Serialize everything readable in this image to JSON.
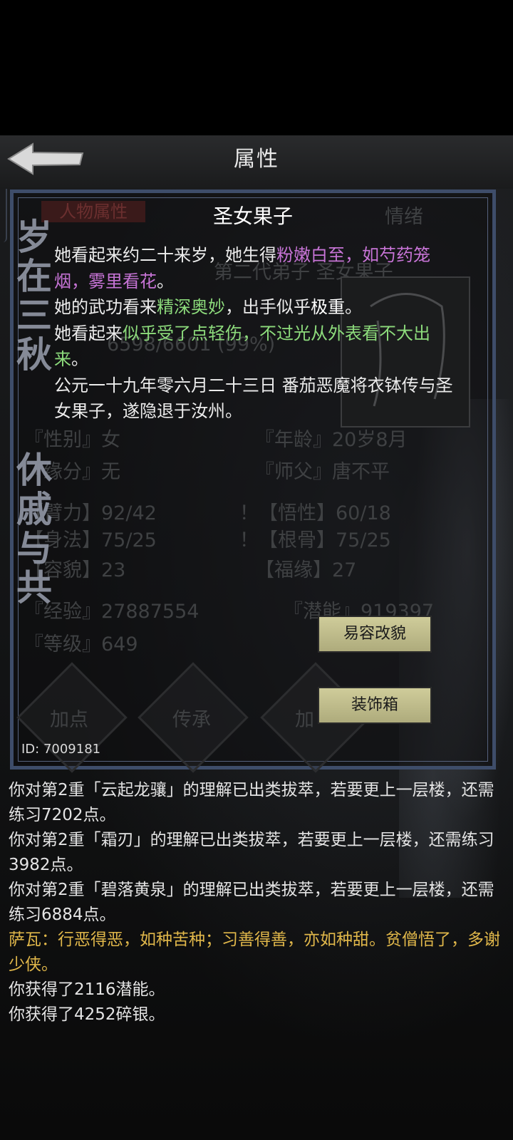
{
  "header": {
    "title": "属性"
  },
  "background": {
    "tab_active": "人物属性",
    "tab_right": "情绪",
    "name_line": "第二代弟子 圣女果子",
    "hp_line": "6598/6601 (99%)",
    "stats_rows": [
      {
        "left": "『性别』女",
        "right": "『年龄』20岁8月"
      },
      {
        "left": "『缘分』无",
        "right": "『师父』唐不平"
      },
      {
        "left": "【臂力】92/42",
        "right": "！【悟性】60/18"
      },
      {
        "left": "【身法】75/25",
        "right": "！【根骨】75/25"
      },
      {
        "left": "【容貌】23",
        "right": "【福缘】27"
      }
    ],
    "exp": "『经验』27887554",
    "potential": "『潜能』919397",
    "level": "『等级』649",
    "diamonds": [
      "加点",
      "传承",
      "加"
    ],
    "calligraphy_top": [
      "岁",
      "在",
      "三",
      "秋"
    ],
    "calligraphy_bottom": [
      "休",
      "戚",
      "与",
      "共"
    ]
  },
  "popup": {
    "title": "圣女果子",
    "p1": {
      "a": "她看起来约二十来岁，她生得",
      "b": "粉嫩白至，如芍药笼烟，雾里看花",
      "c": "。"
    },
    "p2": {
      "a": "她的武功看来",
      "b": "精深奥妙",
      "c": "，出手似乎",
      "d": "极重",
      "e": "。"
    },
    "p3": {
      "a": "她看起来",
      "b": "似乎受了点轻伤，不过光从外表看不大出来",
      "c": "。"
    },
    "p4": "公元一十九年零六月二十三日 番茄恶魔将衣钵传与圣女果子，遂隐退于汝州。"
  },
  "buttons": {
    "disguise": "易容改貌",
    "wardrobe": "装饰箱"
  },
  "id_label": "ID: 7009181",
  "log": [
    {
      "text": "你对第2重「云起龙骧」的理解已出类拔萃，若要更上一层楼，还需练习7202点。",
      "style": "normal"
    },
    {
      "text": "你对第2重「霜刃」的理解已出类拔萃，若要更上一层楼，还需练习3982点。",
      "style": "normal"
    },
    {
      "text": "你对第2重「碧落黄泉」的理解已出类拔萃，若要更上一层楼，还需练习6884点。",
      "style": "normal"
    },
    {
      "text": "萨瓦：行恶得恶，如种苦种；习善得善，亦如种甜。贫僧悟了，多谢少侠。",
      "style": "gold"
    },
    {
      "text": "你获得了2116潜能。",
      "style": "normal"
    },
    {
      "text": "你获得了4252碎银。",
      "style": "normal"
    }
  ],
  "colors": {
    "panel_border": "#3e4d6a",
    "highlight_purple": "#c774d6",
    "highlight_green": "#8ddc7c",
    "button_bg": "#c4c191",
    "log_gold": "#e0b74a"
  }
}
